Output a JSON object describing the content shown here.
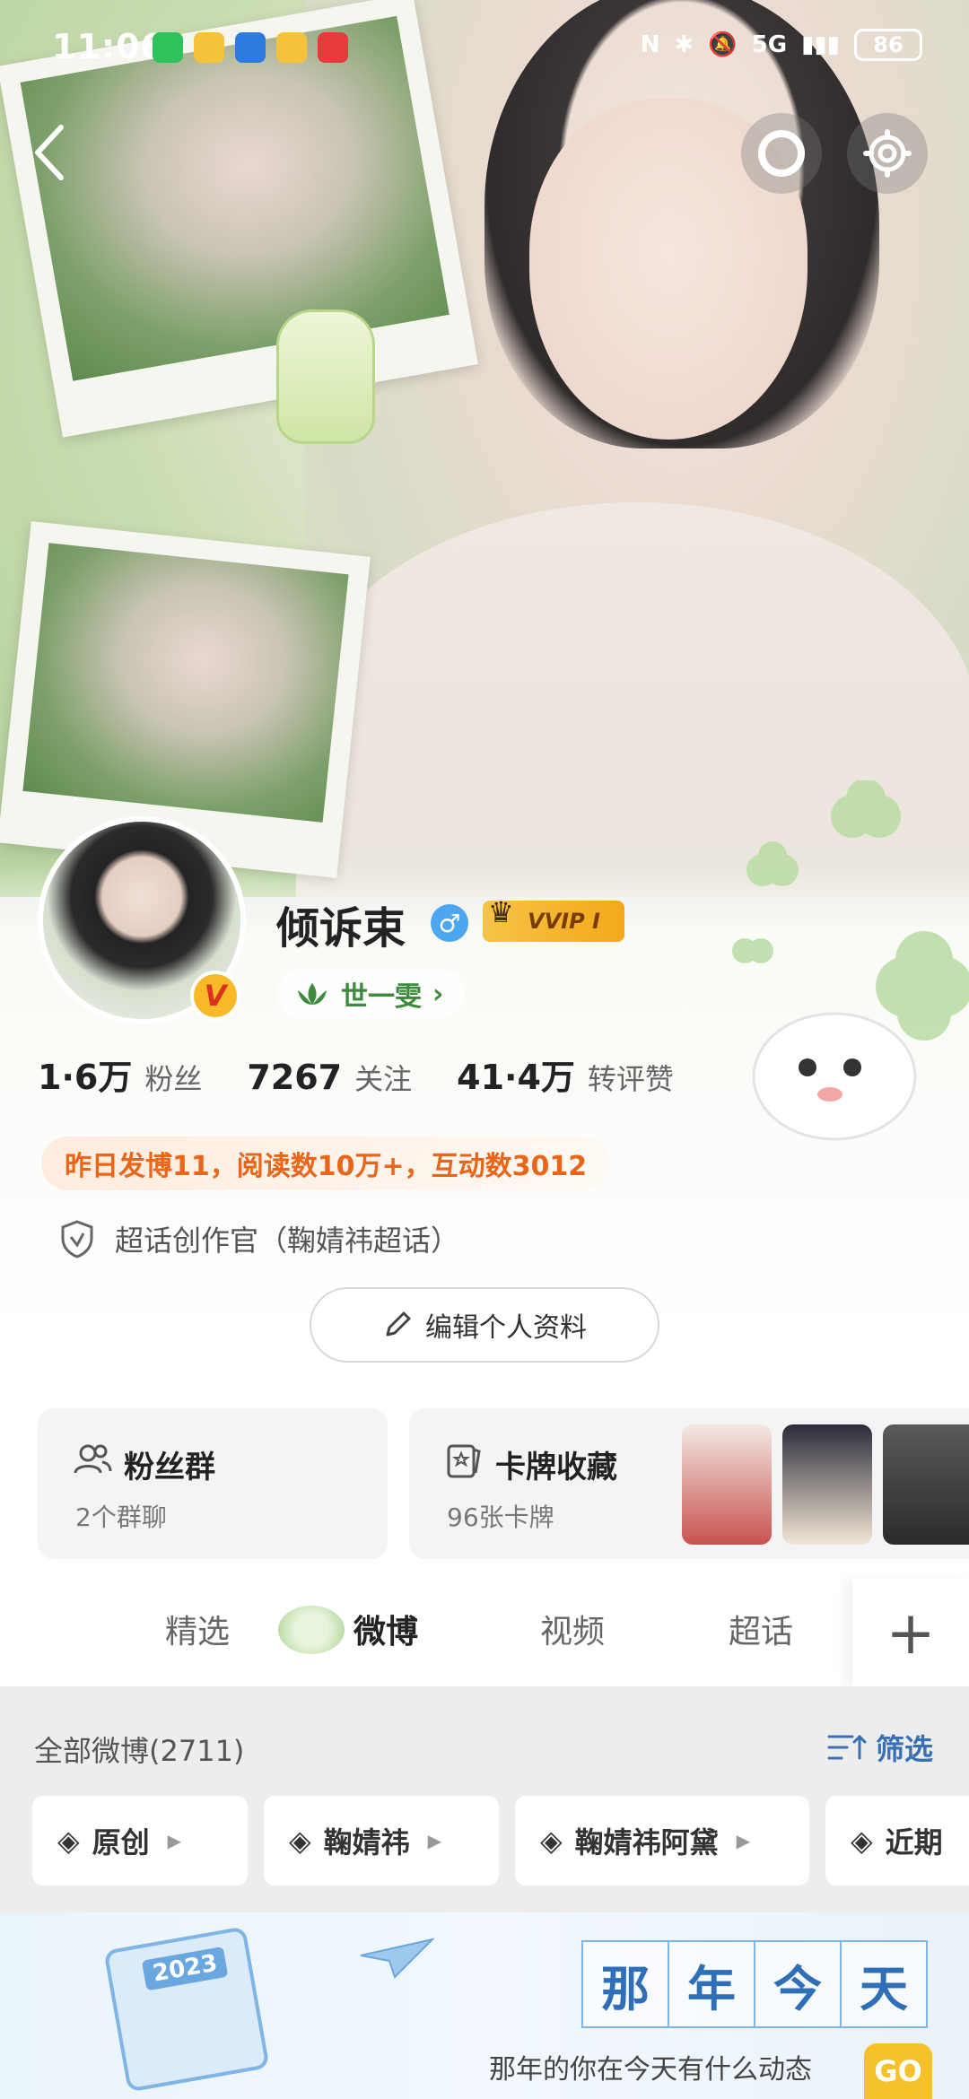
{
  "status_bar": {
    "time": "11:06",
    "network": "5G",
    "battery": "86",
    "apps": [
      "wechat-icon",
      "weibo-icon",
      "shield-icon",
      "weibo-icon",
      "huawei-icon"
    ]
  },
  "header": {
    "back_icon": "chevron-left-icon",
    "refresh_icon": "loading-ring-icon",
    "settings_icon": "gear-icon"
  },
  "profile": {
    "name": "倾诉束",
    "gender": "♂",
    "vip_label": "VVIP I",
    "tag": "世一雯",
    "tag_arrow": "›",
    "avatar_badge": "V"
  },
  "stats": [
    {
      "value": "1·6万",
      "label": "粉丝"
    },
    {
      "value": "7267",
      "label": "关注"
    },
    {
      "value": "41·4万",
      "label": "转评赞"
    }
  ],
  "activity_banner": "昨日发博11，阅读数10万+，互动数3012",
  "verification": "超话创作官（鞠婧祎超话）",
  "edit_profile_label": "编辑个人资料",
  "cards": {
    "fan_group": {
      "title": "粉丝群",
      "subtitle": "2个群聊"
    },
    "card_collection": {
      "title": "卡牌收藏",
      "subtitle": "96张卡牌"
    }
  },
  "tabs": [
    {
      "label": "精选",
      "active": false
    },
    {
      "label": "微博",
      "active": true
    },
    {
      "label": "视频",
      "active": false
    },
    {
      "label": "超话",
      "active": false
    }
  ],
  "tab_plus": "+",
  "weibo_list": {
    "all_label": "全部微博(2711)",
    "filter_label": "筛选",
    "chips": [
      {
        "label": "原创"
      },
      {
        "label": "鞠婧祎"
      },
      {
        "label": "鞠婧祎阿黛"
      },
      {
        "label": "近期"
      }
    ]
  },
  "promo": {
    "calendar_year": "2023",
    "title_chars": [
      "那",
      "年",
      "今",
      "天"
    ],
    "subtitle": "那年的你在今天有什么动态",
    "go_label": "GO"
  },
  "colors": {
    "accent_orange": "#e8661a",
    "link_blue": "#3a6fb3",
    "vip_gold": "#f4a81a",
    "tag_green": "#3d8a3d"
  }
}
